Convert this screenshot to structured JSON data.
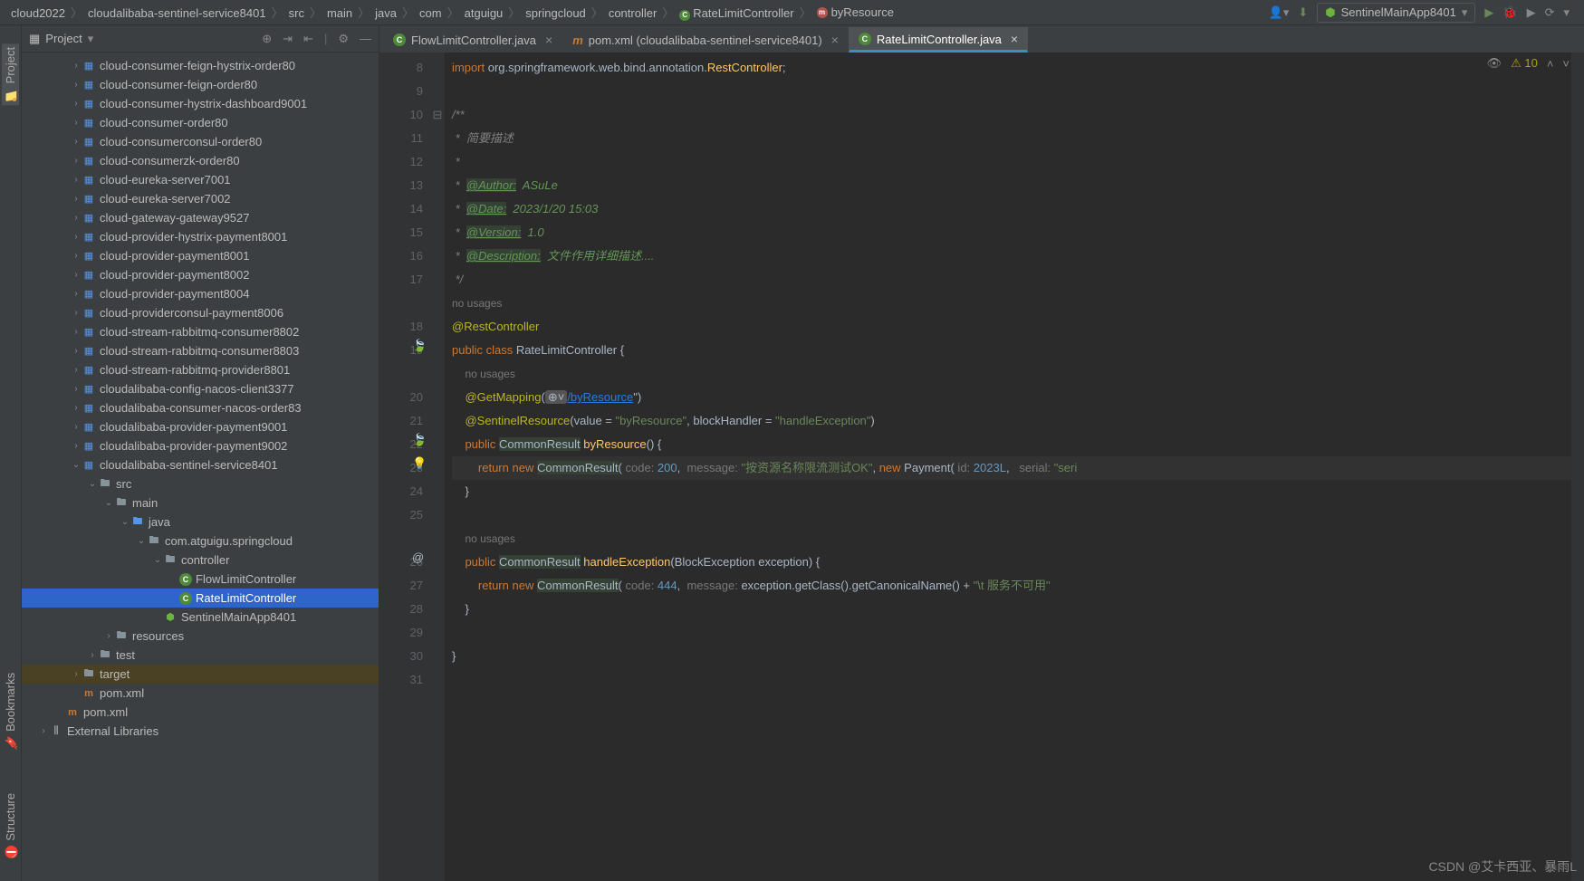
{
  "breadcrumbs": [
    "cloud2022",
    "cloudalibaba-sentinel-service8401",
    "src",
    "main",
    "java",
    "com",
    "atguigu",
    "springcloud",
    "controller",
    "RateLimitController",
    "byResource"
  ],
  "run_config": "SentinelMainApp8401",
  "panel_title": "Project",
  "left_tabs": [
    "Project",
    "Bookmarks",
    "Structure"
  ],
  "tree": [
    {
      "depth": 2,
      "arrow": ">",
      "ico": "module",
      "label": "cloud-consumer-feign-hystrix-order80"
    },
    {
      "depth": 2,
      "arrow": ">",
      "ico": "module",
      "label": "cloud-consumer-feign-order80"
    },
    {
      "depth": 2,
      "arrow": ">",
      "ico": "module",
      "label": "cloud-consumer-hystrix-dashboard9001"
    },
    {
      "depth": 2,
      "arrow": ">",
      "ico": "module",
      "label": "cloud-consumer-order80"
    },
    {
      "depth": 2,
      "arrow": ">",
      "ico": "module",
      "label": "cloud-consumerconsul-order80"
    },
    {
      "depth": 2,
      "arrow": ">",
      "ico": "module",
      "label": "cloud-consumerzk-order80"
    },
    {
      "depth": 2,
      "arrow": ">",
      "ico": "module",
      "label": "cloud-eureka-server7001"
    },
    {
      "depth": 2,
      "arrow": ">",
      "ico": "module",
      "label": "cloud-eureka-server7002"
    },
    {
      "depth": 2,
      "arrow": ">",
      "ico": "module",
      "label": "cloud-gateway-gateway9527"
    },
    {
      "depth": 2,
      "arrow": ">",
      "ico": "module",
      "label": "cloud-provider-hystrix-payment8001"
    },
    {
      "depth": 2,
      "arrow": ">",
      "ico": "module",
      "label": "cloud-provider-payment8001"
    },
    {
      "depth": 2,
      "arrow": ">",
      "ico": "module",
      "label": "cloud-provider-payment8002"
    },
    {
      "depth": 2,
      "arrow": ">",
      "ico": "module",
      "label": "cloud-provider-payment8004"
    },
    {
      "depth": 2,
      "arrow": ">",
      "ico": "module",
      "label": "cloud-providerconsul-payment8006"
    },
    {
      "depth": 2,
      "arrow": ">",
      "ico": "module",
      "label": "cloud-stream-rabbitmq-consumer8802"
    },
    {
      "depth": 2,
      "arrow": ">",
      "ico": "module",
      "label": "cloud-stream-rabbitmq-consumer8803"
    },
    {
      "depth": 2,
      "arrow": ">",
      "ico": "module",
      "label": "cloud-stream-rabbitmq-provider8801"
    },
    {
      "depth": 2,
      "arrow": ">",
      "ico": "module",
      "label": "cloudalibaba-config-nacos-client3377"
    },
    {
      "depth": 2,
      "arrow": ">",
      "ico": "module",
      "label": "cloudalibaba-consumer-nacos-order83"
    },
    {
      "depth": 2,
      "arrow": ">",
      "ico": "module",
      "label": "cloudalibaba-provider-payment9001"
    },
    {
      "depth": 2,
      "arrow": ">",
      "ico": "module",
      "label": "cloudalibaba-provider-payment9002"
    },
    {
      "depth": 2,
      "arrow": "v",
      "ico": "module",
      "label": "cloudalibaba-sentinel-service8401"
    },
    {
      "depth": 3,
      "arrow": "v",
      "ico": "folder",
      "label": "src"
    },
    {
      "depth": 4,
      "arrow": "v",
      "ico": "folder",
      "label": "main"
    },
    {
      "depth": 5,
      "arrow": "v",
      "ico": "folder",
      "label": "java",
      "blue": true
    },
    {
      "depth": 6,
      "arrow": "v",
      "ico": "folder",
      "label": "com.atguigu.springcloud"
    },
    {
      "depth": 7,
      "arrow": "v",
      "ico": "folder",
      "label": "controller"
    },
    {
      "depth": 8,
      "arrow": "",
      "ico": "class",
      "label": "FlowLimitController"
    },
    {
      "depth": 8,
      "arrow": "",
      "ico": "class",
      "label": "RateLimitController",
      "selected": true
    },
    {
      "depth": 7,
      "arrow": "",
      "ico": "spring",
      "label": "SentinelMainApp8401"
    },
    {
      "depth": 4,
      "arrow": ">",
      "ico": "folder",
      "label": "resources"
    },
    {
      "depth": 3,
      "arrow": ">",
      "ico": "folder",
      "label": "test"
    },
    {
      "depth": 2,
      "arrow": ">",
      "ico": "folder",
      "label": "target",
      "hl": true
    },
    {
      "depth": 2,
      "arrow": "",
      "ico": "maven",
      "label": "pom.xml"
    },
    {
      "depth": 1,
      "arrow": "",
      "ico": "maven",
      "label": "pom.xml"
    },
    {
      "depth": 0,
      "arrow": ">",
      "ico": "lib",
      "label": "External Libraries"
    }
  ],
  "tabs": [
    {
      "label": "FlowLimitController.java",
      "active": false,
      "ico": "class"
    },
    {
      "label": "pom.xml (cloudalibaba-sentinel-service8401)",
      "active": false,
      "ico": "maven"
    },
    {
      "label": "RateLimitController.java",
      "active": true,
      "ico": "class"
    }
  ],
  "warnings": "10",
  "code_lines": [
    "8",
    "9",
    "10",
    "11",
    "12",
    "13",
    "14",
    "15",
    "16",
    "17",
    "",
    "18",
    "19",
    "",
    "20",
    "21",
    "22",
    "23",
    "24",
    "25",
    "",
    "26",
    "27",
    "28",
    "29",
    "30",
    "31"
  ],
  "code": {
    "import": "import",
    "pkgpath": " org.springframework.web.bind.annotation.",
    "restc": "RestController",
    "semi": ";",
    "c1": "/**",
    "c2": " *  简要描述",
    "c3": " *",
    "c4": " *  ",
    "a_author": "@Author:",
    "a_author_v": "  ASuLe",
    "a_date": "@Date:",
    "a_date_v": "  2023/1/20 15:03",
    "a_ver": "@Version:",
    "a_ver_v": "  1.0",
    "a_desc": "@Description:",
    "a_desc_v": "  文件作用详细描述....",
    "c5": " */",
    "nou": "no usages",
    "rc": "@RestController",
    "pub": "public",
    "cl": "class",
    "clsname": "RateLimitController",
    "ob": " {",
    "gm": "@GetMapping",
    "gmopen": "(",
    "byres": "\"/byResource\"",
    "gmclose": ")",
    "sr": "@SentinelResource",
    "srargs": "(value = ",
    "srv": "\"byResource\"",
    "srmid": ", blockHandler = ",
    "srh": "\"handleException\"",
    "srclose": ")",
    "cr": "CommonResult",
    "method1": "byResource",
    "paren": "() {",
    "ret": "return",
    "nw": "new",
    "crn": "CommonResult",
    "open": "(",
    "hcod": " code: ",
    "n200": "200",
    "com": ", ",
    "hmsg": " message: ",
    "msg1": "\"按资源名称限流测试OK\"",
    "pay": "Payment",
    "hid": " id: ",
    "n2023": "2023L",
    "hser": "  serial: ",
    "serv": "\"seri",
    "cb": "}",
    "method2": "handleException",
    "args2": "(BlockException exception) {",
    "n444": "444",
    "excall": "exception.getClass().getCanonicalName() + ",
    "tail": "\"\\t 服务不可用\""
  },
  "watermark": "CSDN @艾卡西亚、暴雨L"
}
